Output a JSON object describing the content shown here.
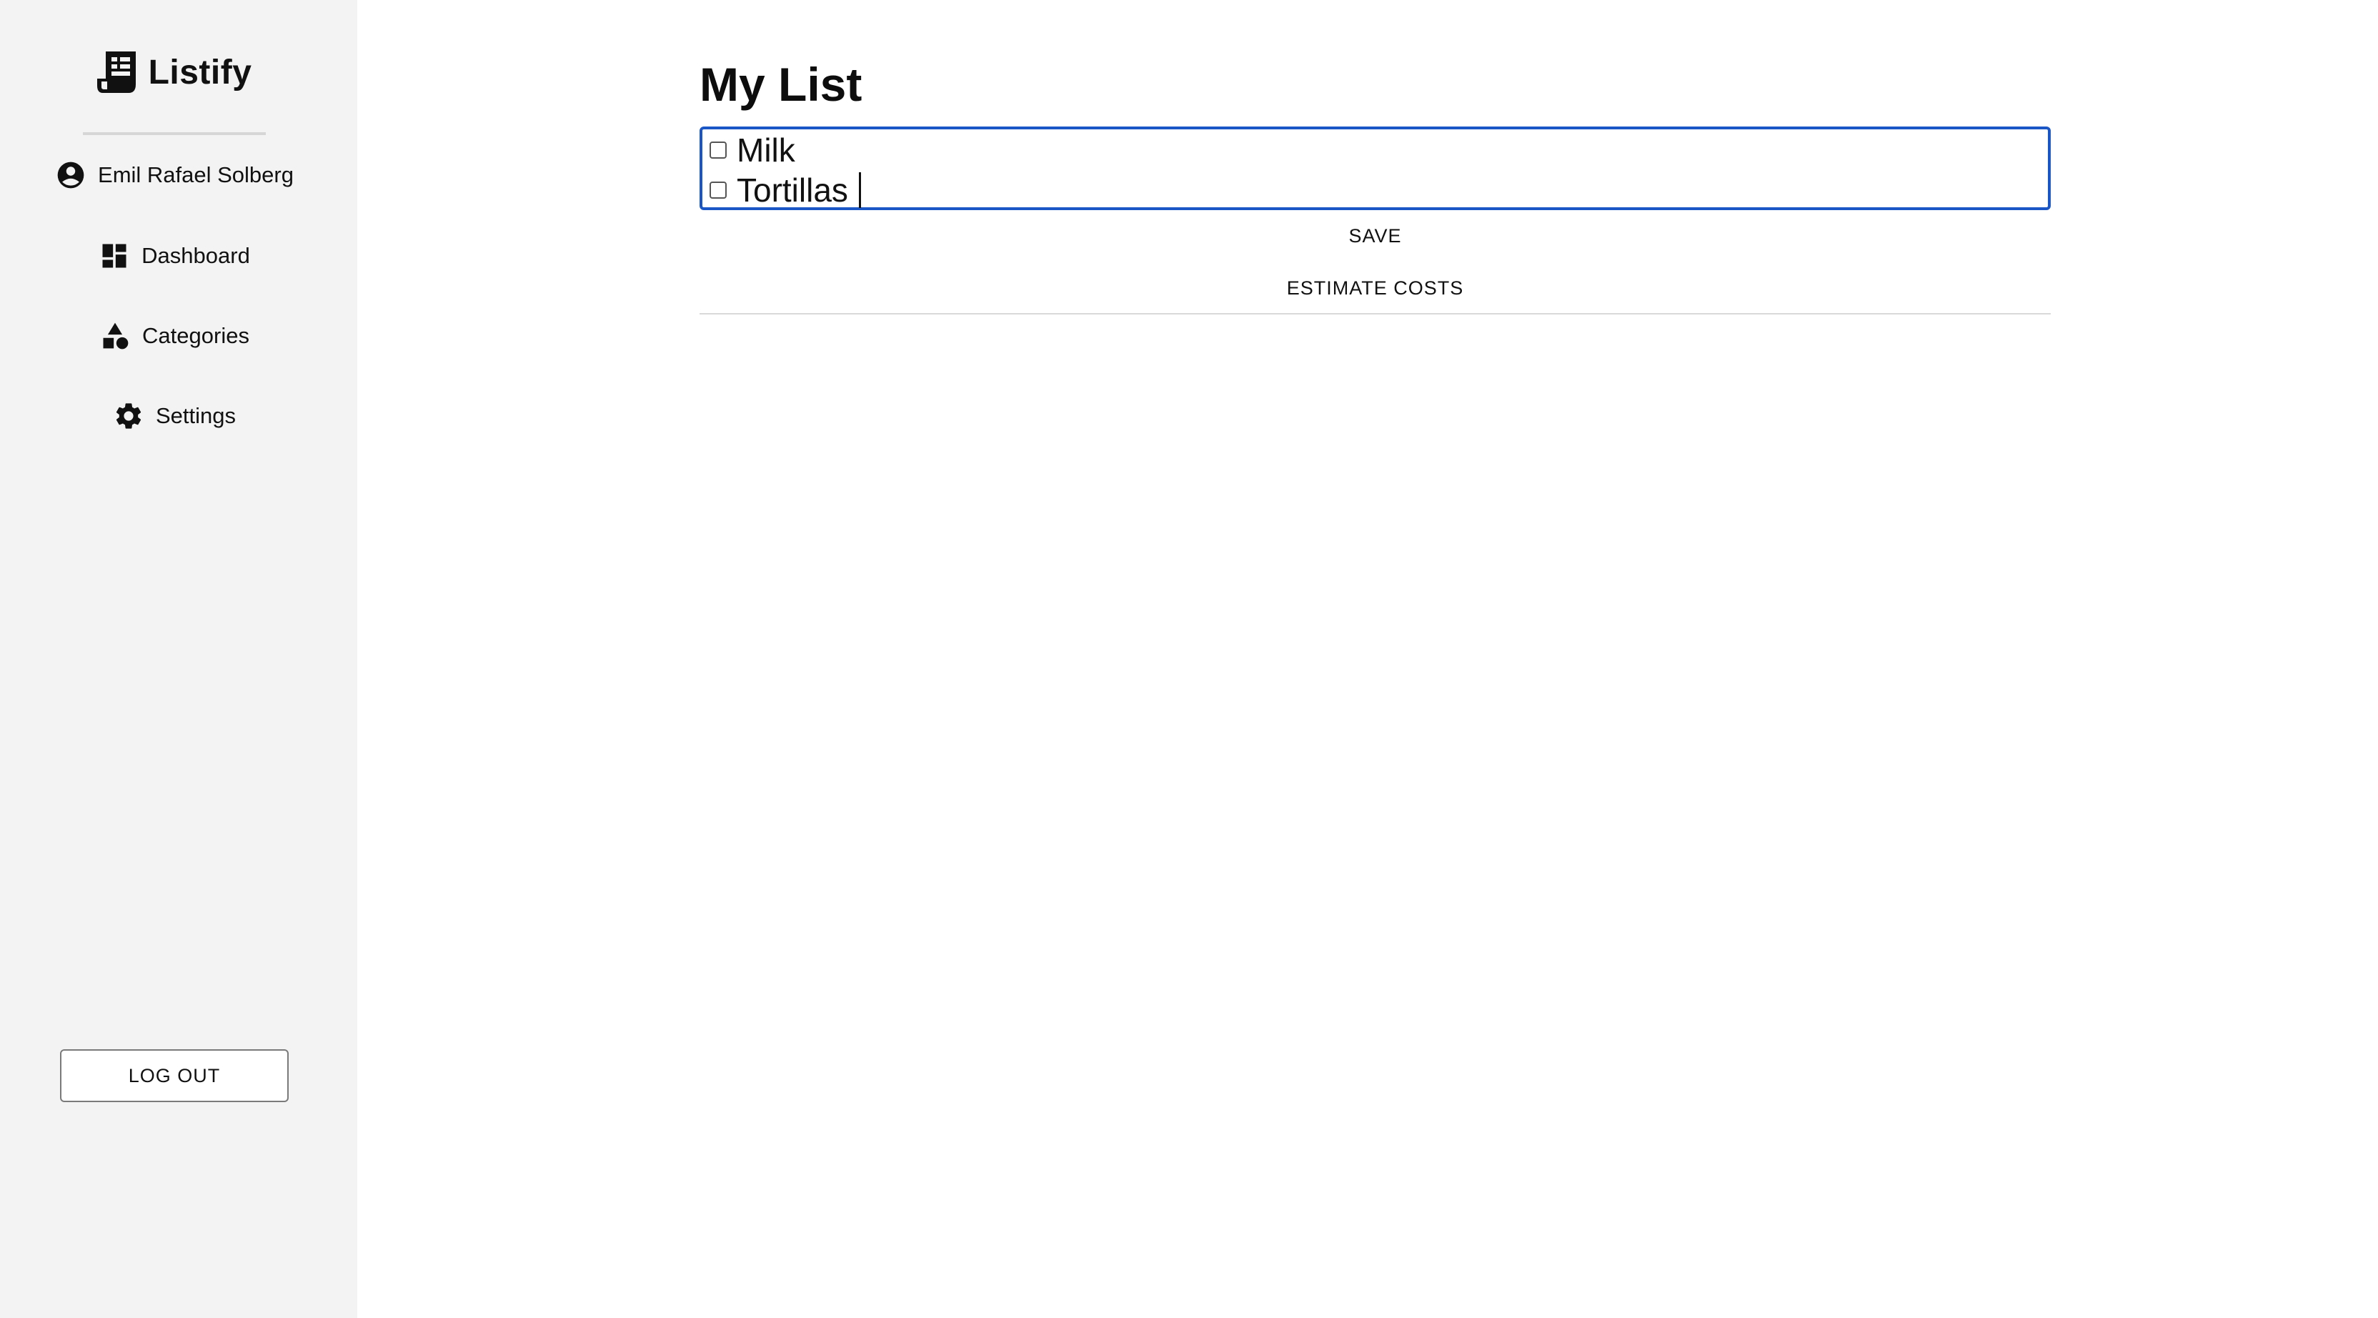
{
  "app": {
    "name": "Listify"
  },
  "sidebar": {
    "user": {
      "name": "Emil Rafael Solberg",
      "icon": "account-circle-icon"
    },
    "items": [
      {
        "label": "Dashboard",
        "icon": "dashboard-icon"
      },
      {
        "label": "Categories",
        "icon": "category-icon"
      },
      {
        "label": "Settings",
        "icon": "gear-icon"
      }
    ],
    "logout_label": "LOG OUT"
  },
  "main": {
    "title": "My List",
    "list_items": [
      {
        "text": "Milk",
        "checked": false
      },
      {
        "text": "Tortillas",
        "checked": false
      }
    ],
    "save_label": "SAVE",
    "estimate_label": "ESTIMATE COSTS"
  },
  "colors": {
    "sidebar_bg": "#f3f3f3",
    "focus_border": "#1b56c7"
  }
}
